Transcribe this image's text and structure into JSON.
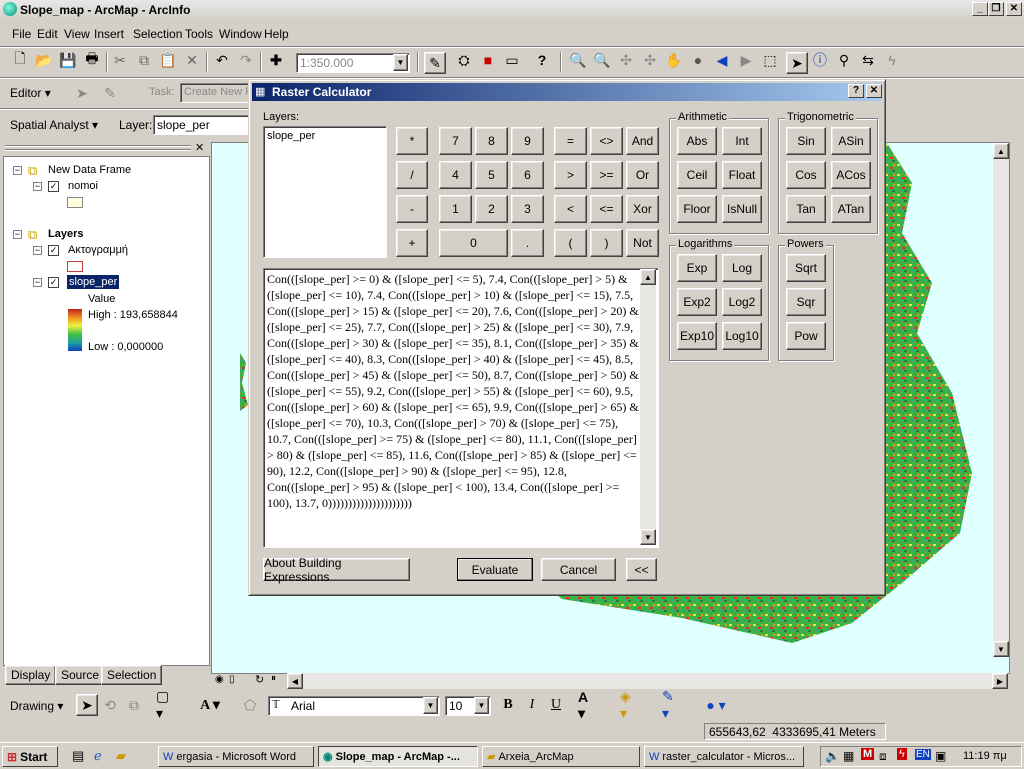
{
  "window": {
    "title": "Slope_map - ArcMap - ArcInfo"
  },
  "menu": [
    "File",
    "Edit",
    "View",
    "Insert",
    "Selection",
    "Tools",
    "Window",
    "Help"
  ],
  "toolbar": {
    "scale_value": "1:350.000"
  },
  "editor": {
    "label": "Editor",
    "task_label": "Task:",
    "task_value": "Create New F"
  },
  "spatial_analyst": {
    "label": "Spatial Analyst",
    "layer_label": "Layer:",
    "layer_value": "slope_per"
  },
  "toc": {
    "frame1": "New Data Frame",
    "layer1": "nomoi",
    "frame2": "Layers",
    "layer2": "Ακτογραμμή",
    "layer3": "slope_per",
    "value_label": "Value",
    "high": "High : 193,658844",
    "low": "Low : 0,000000",
    "tabs": [
      "Display",
      "Source",
      "Selection"
    ]
  },
  "dialog": {
    "title": "Raster Calculator",
    "layers_label": "Layers:",
    "layers_list": [
      "slope_per"
    ],
    "keypad": {
      "row1": [
        "*",
        "7",
        "8",
        "9",
        "=",
        "<>",
        "And"
      ],
      "row2": [
        "/",
        "4",
        "5",
        "6",
        ">",
        ">=",
        "Or"
      ],
      "row3": [
        "-",
        "1",
        "2",
        "3",
        "<",
        "<=",
        "Xor"
      ],
      "row4": [
        "+",
        "0",
        ".",
        "(",
        ")",
        "Not"
      ]
    },
    "arithmetic_label": "Arithmetic",
    "arithmetic": [
      "Abs",
      "Int",
      "Ceil",
      "Float",
      "Floor",
      "IsNull"
    ],
    "trig_label": "Trigonometric",
    "trig": [
      "Sin",
      "ASin",
      "Cos",
      "ACos",
      "Tan",
      "ATan"
    ],
    "log_label": "Logarithms",
    "logs": [
      "Exp",
      "Log",
      "Exp2",
      "Log2",
      "Exp10",
      "Log10"
    ],
    "powers_label": "Powers",
    "powers": [
      "Sqrt",
      "Sqr",
      "Pow"
    ],
    "expression": "Con(([slope_per] >= 0) & ([slope_per] <= 5), 7.4, Con(([slope_per] > 5) & ([slope_per] <= 10), 7.4, Con(([slope_per] > 10) & ([slope_per] <= 15), 7.5, Con(([slope_per] > 15) & ([slope_per] <= 20), 7.6, Con(([slope_per] > 20) & ([slope_per] <= 25), 7.7, Con(([slope_per] > 25) & ([slope_per] <= 30), 7.9,  Con(([slope_per] > 30) & ([slope_per] <= 35), 8.1, Con(([slope_per] > 35) & ([slope_per] <= 40), 8.3, Con(([slope_per] > 40) & ([slope_per] <= 45), 8.5, Con(([slope_per] > 45) & ([slope_per] <= 50), 8.7,  Con(([slope_per] > 50) & ([slope_per] <= 55), 9.2, Con(([slope_per] > 55) & ([slope_per] <= 60), 9.5, Con(([slope_per] > 60) & ([slope_per] <= 65), 9.9, Con(([slope_per] > 65) & ([slope_per] <= 70), 10.3,  Con(([slope_per] > 70) & ([slope_per] <= 75), 10.7, Con(([slope_per] >= 75) & ([slope_per] <= 80), 11.1, Con(([slope_per] > 80) & ([slope_per] <= 85), 11.6, Con(([slope_per] > 85) & ([slope_per] <= 90), 12.2,  Con(([slope_per] > 90) & ([slope_per] <= 95), 12.8, Con(([slope_per] > 95) & ([slope_per] < 100), 13.4, Con(([slope_per] >= 100), 13.7, 0)))))))))))))))))))))",
    "about_btn": "About Building Expressions",
    "evaluate_btn": "Evaluate",
    "cancel_btn": "Cancel",
    "collapse_btn": "<<"
  },
  "drawing": {
    "label": "Drawing",
    "font": "Arial",
    "size": "10"
  },
  "status": {
    "coords": "655643,62  4333695,41 Meters"
  },
  "taskbar": {
    "start": "Start",
    "tasks": [
      "ergasia - Microsoft Word",
      "Slope_map - ArcMap -...",
      "Arxeia_ArcMap",
      "raster_calculator - Micros..."
    ],
    "tray_lang": "EN",
    "clock": "11:19 πμ"
  }
}
